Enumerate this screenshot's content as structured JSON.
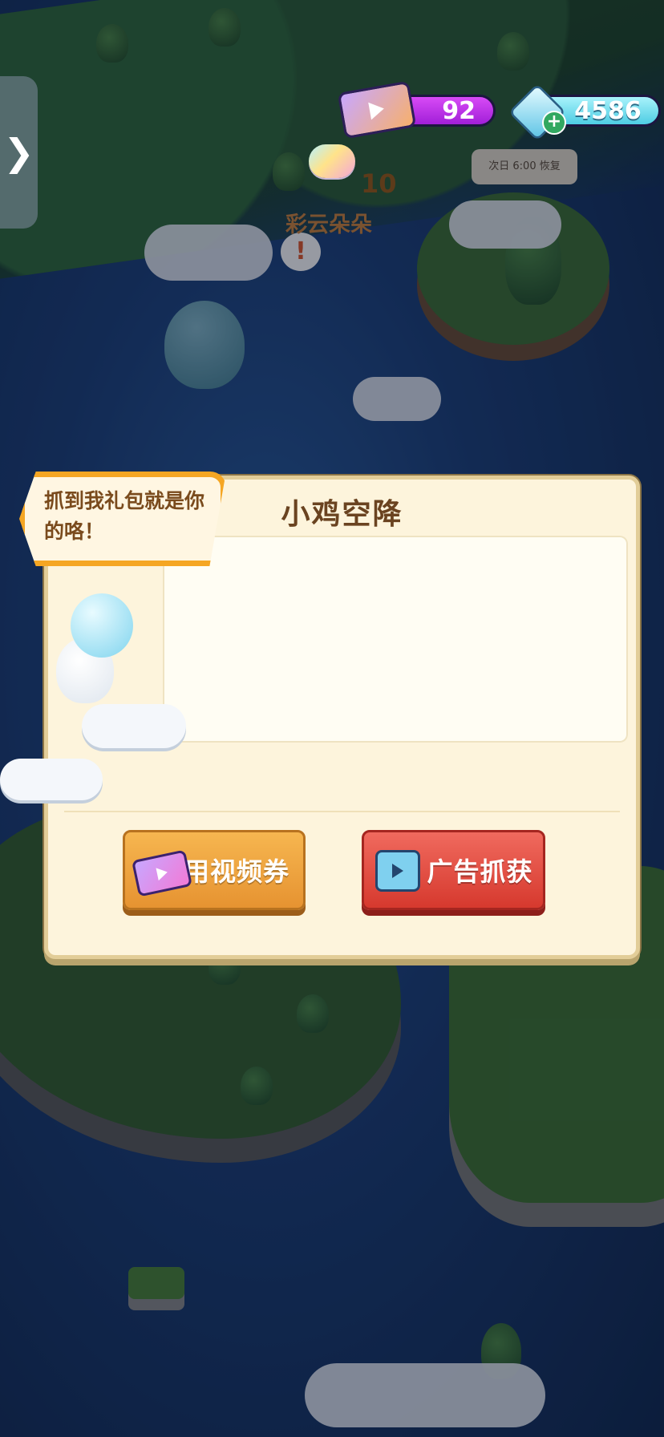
{
  "hud": {
    "side_tab_glyph": "❯",
    "video_tickets": "92",
    "gems": "4586",
    "gem_add_glyph": "+",
    "tree_sign": "次日 6:00 恢复"
  },
  "modal": {
    "title": "小鸡空降",
    "speech": "抓到我礼包就是你的咯！",
    "reward": {
      "icon": "rainbow-cloud-icon",
      "count": "10",
      "name": "彩云朵朵"
    },
    "buttons": {
      "video_ticket": "用视频券",
      "watch_ad": "广告抓获"
    }
  },
  "colors": {
    "ticket_bar": "#c236ea",
    "gem_bar": "#6fdcec",
    "video_button": "#f0a23d",
    "ad_button": "#e34c40",
    "title": "#6a4320"
  }
}
